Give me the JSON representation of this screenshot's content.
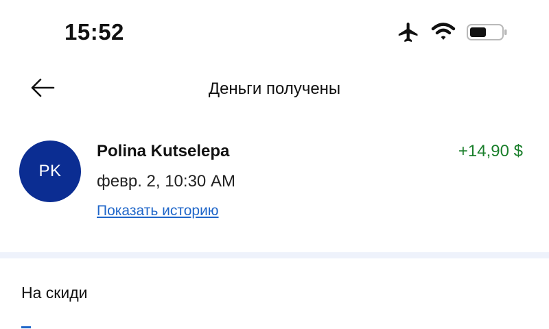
{
  "status_bar": {
    "time": "15:52",
    "icons": [
      "airplane-icon",
      "wifi-icon",
      "battery-icon"
    ]
  },
  "header": {
    "back_icon": "arrow-left-icon",
    "title": "Деньги получены"
  },
  "transaction": {
    "avatar_initials": "PK",
    "sender_name": "Polina Kutselepa",
    "amount": "+14,90 $",
    "timestamp": "февр. 2, 10:30 AM",
    "history_link": "Показать историю"
  },
  "details": {
    "note": "На скиди"
  },
  "colors": {
    "avatar_background": "#0b2d92",
    "amount_positive": "#1a7f2b",
    "link": "#1f66c9",
    "divider": "#eef2fb"
  }
}
